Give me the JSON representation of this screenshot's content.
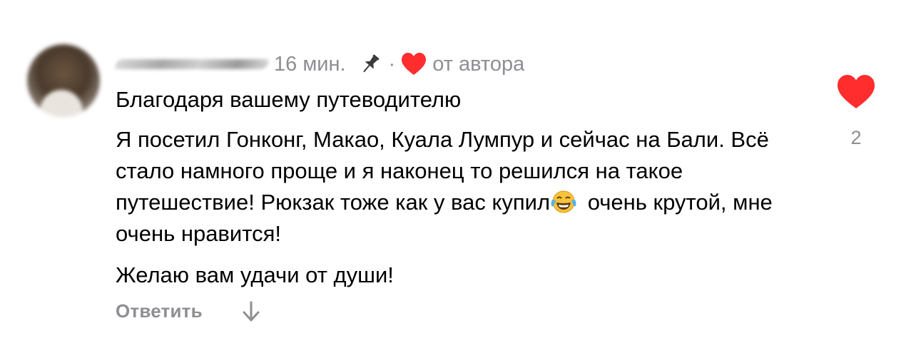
{
  "comment": {
    "time": "16 мин.",
    "separator": "·",
    "author_tag": "от автора",
    "paragraphs": [
      "Благодаря вашему путеводителю",
      {
        "before_emoji": "Я посетил Гонконг, Макао, Куала Лумпур и сейчас на Бали. Всё стало намного проще и я наконец то решился на такое путешествие! Рюкзак тоже как у вас купил",
        "emoji": "face-with-tears-of-joy-icon",
        "after_emoji": " очень крутой, мне очень нравится!"
      },
      "Желаю вам удачи от души!"
    ],
    "reply_label": "Ответить",
    "like_count": "2",
    "colors": {
      "heart": "#ff2d2d",
      "meta_text": "#8e8e93",
      "body_text": "#000000"
    },
    "icons": [
      "pin-icon",
      "heart-icon",
      "arrow-down-icon",
      "like-heart-icon"
    ]
  }
}
